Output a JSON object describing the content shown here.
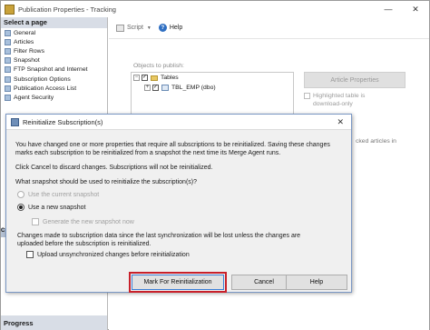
{
  "window": {
    "title": "Publication Properties - Tracking",
    "minimize": "—",
    "close": "✕"
  },
  "sidebar": {
    "header": "Select a page",
    "items": [
      {
        "label": "General"
      },
      {
        "label": "Articles"
      },
      {
        "label": "Filter Rows"
      },
      {
        "label": "Snapshot"
      },
      {
        "label": "FTP Snapshot and Internet"
      },
      {
        "label": "Subscription Options"
      },
      {
        "label": "Publication Access List"
      },
      {
        "label": "Agent Security"
      }
    ],
    "progress_header": "Progress",
    "collapsed_letter": "C"
  },
  "toolbar": {
    "script_label": "Script",
    "script_arrow": "▼",
    "help_label": "Help",
    "help_glyph": "?"
  },
  "main": {
    "objects_label": "Objects to publish:",
    "tree": {
      "root_label": "Tables",
      "child_label": "TBL_EMP (dbo)",
      "root_expander": "−",
      "child_expander": "+",
      "check": "✓"
    },
    "article_properties_label": "Article Properties",
    "highlight_note_line1": "Highlighted table is",
    "highlight_note_line2": "download-only",
    "right_partial_text": "cked articles in"
  },
  "dialog": {
    "title": "Reinitialize Subscription(s)",
    "close": "✕",
    "message_line1": "You have changed one or more properties that require all subscriptions to be reinitialized. Saving these changes",
    "message_line2": "marks each subscription to be reinitialized from a snapshot the next time its Merge Agent runs.",
    "cancel_note": "Click Cancel to discard changes. Subscriptions will not be reinitialized.",
    "snapshot_question": "What snapshot should be used to reinitialize the subscription(s)?",
    "option_current": "Use the current snapshot",
    "option_new": "Use a new snapshot",
    "generate_label": "Generate the new snapshot now",
    "warning_line1": "Changes made to subscription data since the last synchronization will be lost unless the changes are",
    "warning_line2": "uploaded before the subscription is reinitialized.",
    "upload_label": "Upload unsynchronized changes before reinitialization",
    "buttons": {
      "mark": "Mark For Reinitialization",
      "cancel": "Cancel",
      "help": "Help"
    }
  }
}
